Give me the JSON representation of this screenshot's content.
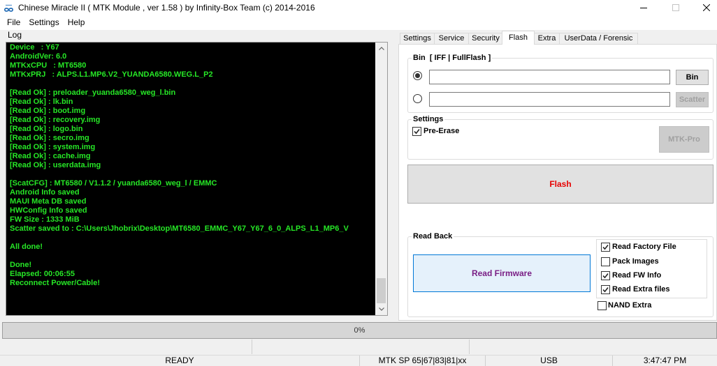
{
  "window": {
    "title": "Chinese Miracle II ( MTK Module , ver 1.58 ) by Infinity-Box Team (c) 2014-2016",
    "icon": "infinity-box-logo-icon"
  },
  "menu": {
    "items": [
      "File",
      "Settings",
      "Help"
    ]
  },
  "log": {
    "label": "Log",
    "lines": [
      "Device   : Y67",
      "AndroidVer: 6.0",
      "MTKxCPU   : MT6580",
      "MTKxPRJ   : ALPS.L1.MP6.V2_YUANDA6580.WEG.L_P2",
      "",
      "[Read Ok] : preloader_yuanda6580_weg_l.bin",
      "[Read Ok] : lk.bin",
      "[Read Ok] : boot.img",
      "[Read Ok] : recovery.img",
      "[Read Ok] : logo.bin",
      "[Read Ok] : secro.img",
      "[Read Ok] : system.img",
      "[Read Ok] : cache.img",
      "[Read Ok] : userdata.img",
      "",
      "[ScatCFG] : MT6580 / V1.1.2 / yuanda6580_weg_l / EMMC",
      "Android Info saved",
      "MAUI Meta DB saved",
      "HWConfig Info saved",
      "FW Size : 1333 MiB",
      "Scatter saved to : C:\\Users\\Jhobrix\\Desktop\\MT6580_EMMC_Y67_Y67_6_0_ALPS_L1_MP6_V",
      "",
      "All done!",
      "",
      "Done!",
      "Elapsed: 00:06:55",
      "Reconnect Power/Cable!"
    ]
  },
  "tabs": [
    {
      "label": "Settings",
      "active": false
    },
    {
      "label": "Service",
      "active": false
    },
    {
      "label": "Security",
      "active": false
    },
    {
      "label": "Flash",
      "active": true
    },
    {
      "label": "Extra",
      "active": false
    },
    {
      "label": "UserData / Forensic",
      "active": false
    }
  ],
  "flash_tab": {
    "bin_group": {
      "title": "Bin  [ IFF | FullFlash ]",
      "bin_selected": true,
      "scatter_selected": false,
      "bin_path": "",
      "scatter_path": "",
      "bin_button": "Bin",
      "scatter_button": "Scatter",
      "scatter_enabled": false
    },
    "settings_group": {
      "title": "Settings",
      "pre_erase": {
        "label": "Pre-Erase",
        "checked": true
      },
      "mtk_pro_button": "MTK-Pro",
      "mtk_pro_enabled": false
    },
    "flash_button": "Flash",
    "read_back": {
      "title": "Read Back",
      "read_firmware_button": "Read Firmware",
      "options": [
        {
          "label": "Read Factory File",
          "checked": true
        },
        {
          "label": "Pack Images",
          "checked": false
        },
        {
          "label": "Read FW Info",
          "checked": true
        },
        {
          "label": "Read Extra files",
          "checked": true
        }
      ],
      "nand_extra": {
        "label": "NAND Extra",
        "checked": false
      }
    }
  },
  "progress": {
    "value": 0,
    "label": "0%"
  },
  "status_bar": {
    "state": "READY",
    "protocol": "MTK SP 65|67|83|81|xx",
    "connection": "USB",
    "time": "3:47:47 PM"
  },
  "colors": {
    "log_background": "#000000",
    "log_text": "#26e626",
    "flash_label": "#e60000",
    "read_firmware_label": "#7a1f85",
    "read_firmware_background": "#e5f1fb",
    "read_firmware_border": "#0078d7"
  }
}
